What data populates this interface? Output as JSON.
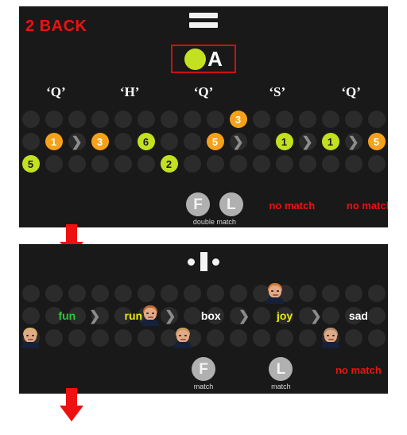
{
  "panel_nback": {
    "title": "2 BACK",
    "equals_icon": "equals-icon",
    "cue": {
      "letter": "A",
      "dot_color": "#c3e021",
      "border_color": "#cc1111"
    },
    "column_headers": [
      "‘Q’",
      "‘H’",
      "‘Q’",
      "‘S’",
      "‘Q’"
    ],
    "tokens": [
      {
        "row": 1,
        "col": 10,
        "value": "3",
        "color": "orange"
      },
      {
        "row": 2,
        "col": 2,
        "value": "1",
        "color": "orange"
      },
      {
        "row": 2,
        "col": 4,
        "value": "3",
        "color": "orange"
      },
      {
        "row": 2,
        "col": 6,
        "value": "6",
        "color": "green"
      },
      {
        "row": 2,
        "col": 9,
        "value": "5",
        "color": "orange"
      },
      {
        "row": 2,
        "col": 12,
        "value": "1",
        "color": "green"
      },
      {
        "row": 2,
        "col": 14,
        "value": "1",
        "color": "green"
      },
      {
        "row": 3,
        "col": 1,
        "value": "5",
        "color": "green"
      },
      {
        "row": 3,
        "col": 7,
        "value": "2",
        "color": "green"
      },
      {
        "row": 2,
        "col": 16,
        "value": "5",
        "color": "orange"
      }
    ],
    "chevrons": [
      {
        "row": 2,
        "col": 3
      },
      {
        "row": 2,
        "col": 10
      },
      {
        "row": 2,
        "col": 13
      },
      {
        "row": 2,
        "col": 15
      }
    ],
    "results": [
      {
        "type": "circle",
        "letter": "F",
        "x_pct": 48.5
      },
      {
        "type": "circle",
        "letter": "L",
        "x_pct": 57.5
      },
      {
        "type": "label",
        "text": "double match",
        "x_pct": 53.0
      },
      {
        "type": "nomatch",
        "text": "no match",
        "x_pct": 74.0
      },
      {
        "type": "nomatch",
        "text": "no match",
        "x_pct": 95.0
      }
    ]
  },
  "panel_words": {
    "center_icon": "bar-with-dots-icon",
    "words": [
      {
        "text": "fun",
        "color": "#22cc33",
        "x_pct": 13.0
      },
      {
        "text": "run",
        "color": "#e8e81c",
        "x_pct": 31.0
      },
      {
        "text": "box",
        "color": "#ffffff",
        "x_pct": 52.0
      },
      {
        "text": "joy",
        "color": "#e8e81c",
        "x_pct": 72.0
      },
      {
        "text": "sad",
        "color": "#ffffff",
        "x_pct": 92.0
      }
    ],
    "faces": [
      {
        "row": 2,
        "x_pct": 35.5,
        "hair": "#c06a30",
        "name": "face-run"
      },
      {
        "row": 1,
        "x_pct": 69.5,
        "hair": "#d07a35",
        "name": "face-joy"
      },
      {
        "row": 3,
        "x_pct": 3.0,
        "hair": "#d8b070",
        "name": "face-row3-a"
      },
      {
        "row": 3,
        "x_pct": 44.5,
        "hair": "#c89a60",
        "name": "face-row3-b"
      },
      {
        "row": 3,
        "x_pct": 84.5,
        "hair": "#b09070",
        "name": "face-row3-c"
      }
    ],
    "chevrons": [
      {
        "row": 2,
        "x_pct": 20.5
      },
      {
        "row": 2,
        "x_pct": 41.0
      },
      {
        "row": 2,
        "x_pct": 61.0
      },
      {
        "row": 2,
        "x_pct": 80.5
      }
    ],
    "results": [
      {
        "type": "circle",
        "letter": "F",
        "x_pct": 50.0
      },
      {
        "type": "label",
        "text": "match",
        "x_pct": 50.0
      },
      {
        "type": "circle",
        "letter": "L",
        "x_pct": 71.0
      },
      {
        "type": "label",
        "text": "match",
        "x_pct": 71.0
      },
      {
        "type": "nomatch",
        "text": "no match",
        "x_pct": 92.0
      }
    ]
  },
  "arrows": {
    "color": "#ee1111",
    "count": 2
  },
  "grid": {
    "rows": 3,
    "columns": 16
  }
}
